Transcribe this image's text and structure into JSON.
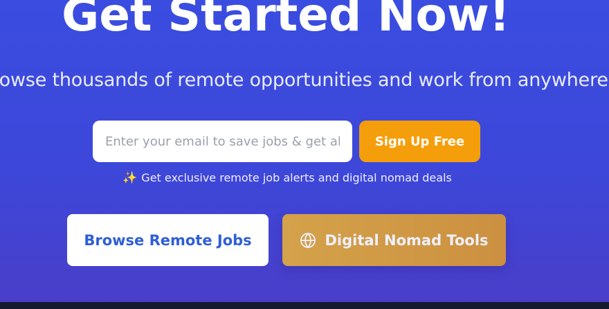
{
  "hero": {
    "title": "Get Started Now!",
    "subtitle": "Browse thousands of remote opportunities and work from anywhere"
  },
  "signup": {
    "email_placeholder": "Enter your email to save jobs & get alerts",
    "button_label": "Sign Up Free",
    "perk_text": "Get exclusive remote job alerts and digital nomad deals",
    "perk_icon": "sparkles-icon"
  },
  "actions": {
    "browse_label": "Browse Remote Jobs",
    "tools_label": "Digital Nomad Tools",
    "tools_icon": "globe-icon"
  },
  "colors": {
    "background": "#3d47d9",
    "accent_orange": "#f59e0b",
    "tools_gold": "#d4a24a",
    "browse_text": "#2f5fd6"
  }
}
